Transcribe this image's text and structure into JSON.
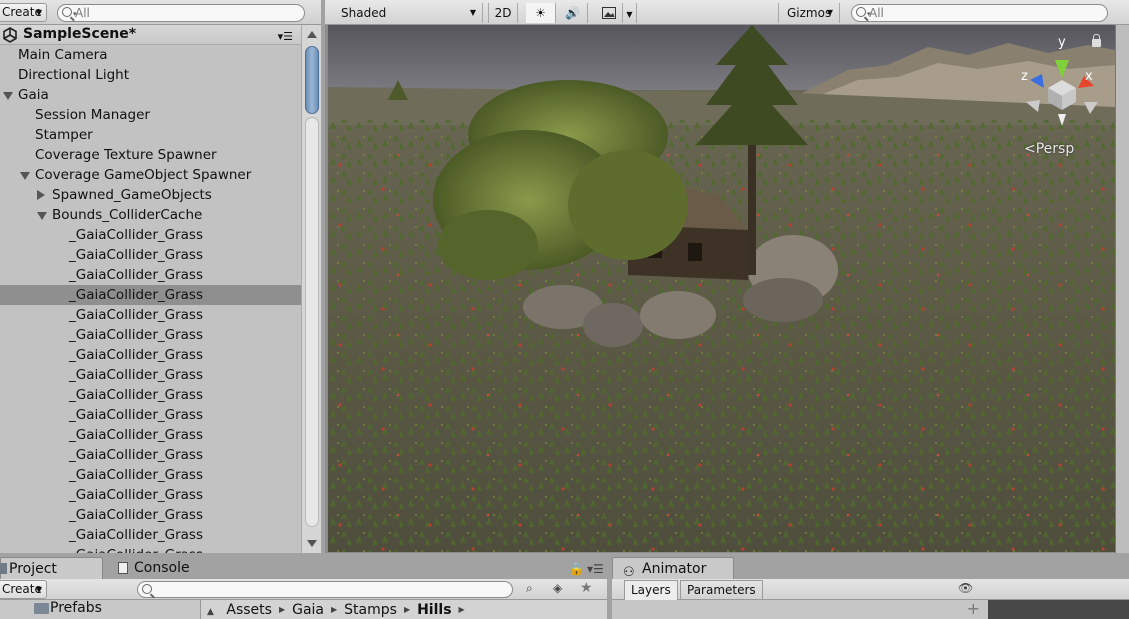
{
  "hierarchy": {
    "create_label": "Create",
    "search_placeholder": "All",
    "scene_name": "SampleScene*",
    "items": [
      {
        "label": "Main Camera",
        "depth": 0,
        "expander": "none"
      },
      {
        "label": "Directional Light",
        "depth": 0,
        "expander": "none"
      },
      {
        "label": "Gaia",
        "depth": 0,
        "expander": "expanded"
      },
      {
        "label": "Session Manager",
        "depth": 1,
        "expander": "none"
      },
      {
        "label": "Stamper",
        "depth": 1,
        "expander": "none"
      },
      {
        "label": "Coverage Texture Spawner",
        "depth": 1,
        "expander": "none"
      },
      {
        "label": "Coverage GameObject Spawner",
        "depth": 1,
        "expander": "expanded"
      },
      {
        "label": "Spawned_GameObjects",
        "depth": 2,
        "expander": "collapsed"
      },
      {
        "label": "Bounds_ColliderCache",
        "depth": 2,
        "expander": "expanded"
      },
      {
        "label": "_GaiaCollider_Grass",
        "depth": 3,
        "expander": "none"
      },
      {
        "label": "_GaiaCollider_Grass",
        "depth": 3,
        "expander": "none"
      },
      {
        "label": "_GaiaCollider_Grass",
        "depth": 3,
        "expander": "none"
      },
      {
        "label": "_GaiaCollider_Grass",
        "depth": 3,
        "expander": "none",
        "selected": true
      },
      {
        "label": "_GaiaCollider_Grass",
        "depth": 3,
        "expander": "none"
      },
      {
        "label": "_GaiaCollider_Grass",
        "depth": 3,
        "expander": "none"
      },
      {
        "label": "_GaiaCollider_Grass",
        "depth": 3,
        "expander": "none"
      },
      {
        "label": "_GaiaCollider_Grass",
        "depth": 3,
        "expander": "none"
      },
      {
        "label": "_GaiaCollider_Grass",
        "depth": 3,
        "expander": "none"
      },
      {
        "label": "_GaiaCollider_Grass",
        "depth": 3,
        "expander": "none"
      },
      {
        "label": "_GaiaCollider_Grass",
        "depth": 3,
        "expander": "none"
      },
      {
        "label": "_GaiaCollider_Grass",
        "depth": 3,
        "expander": "none"
      },
      {
        "label": "_GaiaCollider_Grass",
        "depth": 3,
        "expander": "none"
      },
      {
        "label": "_GaiaCollider_Grass",
        "depth": 3,
        "expander": "none"
      },
      {
        "label": "_GaiaCollider_Grass",
        "depth": 3,
        "expander": "none"
      },
      {
        "label": "_GaiaCollider_Grass",
        "depth": 3,
        "expander": "none"
      },
      {
        "label": "_GaiaCollider_Grass",
        "depth": 3,
        "expander": "none"
      }
    ]
  },
  "scene_view": {
    "shading_mode": "Shaded",
    "btn_2d": "2D",
    "gizmos_label": "Gizmos",
    "search_placeholder": "All",
    "projection_label": "Persp",
    "gizmo_axes": {
      "y": "y",
      "x": "x",
      "z": "z"
    },
    "colors": {
      "axis_y": "#7fd03a",
      "axis_x": "#e8462c",
      "axis_z": "#3a6fe0",
      "sky": "#5c5c62",
      "ground": "#5b5a46"
    }
  },
  "bottom": {
    "project_tab": "Project",
    "console_tab": "Console",
    "create_label": "Create",
    "folder_label": "Prefabs",
    "breadcrumb": [
      "Assets",
      "Gaia",
      "Stamps",
      "Hills"
    ],
    "animator_tab": "Animator",
    "layers_tab": "Layers",
    "parameters_tab": "Parameters"
  }
}
